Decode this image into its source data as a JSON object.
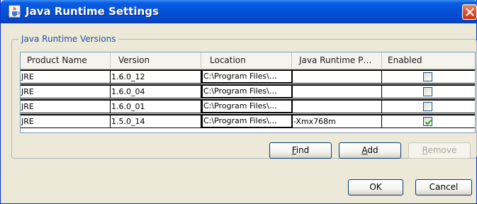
{
  "window": {
    "title": "Java Runtime Settings"
  },
  "group": {
    "label": "Java Runtime Versions"
  },
  "table": {
    "columns": [
      "Product Name",
      "Version",
      "Location",
      "Java Runtime P…",
      "Enabled"
    ],
    "rows": [
      {
        "product": "JRE",
        "version": "1.6.0_12",
        "location": "C:\\Program Files\\…",
        "params": "",
        "enabled": false
      },
      {
        "product": "JRE",
        "version": "1.6.0_04",
        "location": "C:\\Program Files\\…",
        "params": "",
        "enabled": false
      },
      {
        "product": "JRE",
        "version": "1.6.0_01",
        "location": "C:\\Program Files\\…",
        "params": "",
        "enabled": false
      },
      {
        "product": "JRE",
        "version": "1.5.0_14",
        "location": "C:\\Program Files\\…",
        "params": "-Xmx768m",
        "enabled": true
      }
    ]
  },
  "buttons": {
    "find": {
      "mnemonic": "F",
      "rest": "ind"
    },
    "add": {
      "mnemonic": "A",
      "rest": "dd"
    },
    "remove": {
      "mnemonic": "R",
      "rest": "emove"
    },
    "ok": "OK",
    "cancel": "Cancel"
  },
  "icons": {
    "window": "java-cup-icon",
    "close": "close-icon",
    "check": "checkmark-icon"
  },
  "colors": {
    "titlebar": "#0553d8",
    "close": "#e0532b",
    "group_label": "#2350a8",
    "check": "#21a121"
  }
}
